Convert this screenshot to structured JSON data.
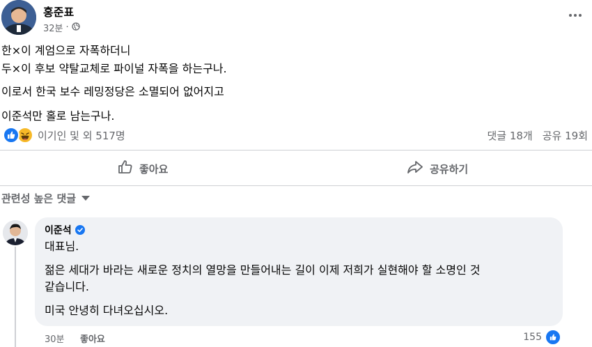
{
  "post": {
    "author": "홍준표",
    "time": "32분",
    "privacy_icon": "globe-icon",
    "lines": [
      "한×이 계엄으로 자폭하더니",
      "두×이 후보 약탈교체로 파이널 자폭을 하는구나.",
      "이로서 한국 보수 레밍정당은 소멸되어 없어지고",
      "이준석만 홀로 남는구나."
    ],
    "reactions_text": "이기인 및 외 517명",
    "comments_count": "댓글 18개",
    "shares_count": "공유 19회"
  },
  "actions": {
    "like_label": "좋아요",
    "share_label": "공유하기"
  },
  "comments_sort": {
    "label": "관련성 높은 댓글"
  },
  "comment": {
    "author": "이준석",
    "lines": [
      "대표님.",
      "젊은 세대가 바라는 새로운 정치의 열망을 만들어내는 길이 이제 저희가 실현해야 할 소명인 것",
      "같습니다.",
      "미국 안녕히 다녀오십시오."
    ],
    "time": "30분",
    "like_label": "좋아요",
    "reaction_count": "155"
  },
  "colors": {
    "accent": "#1877f2",
    "secondary_text": "#65676b",
    "bubble": "#f0f2f5",
    "haha": "#f7b928"
  }
}
